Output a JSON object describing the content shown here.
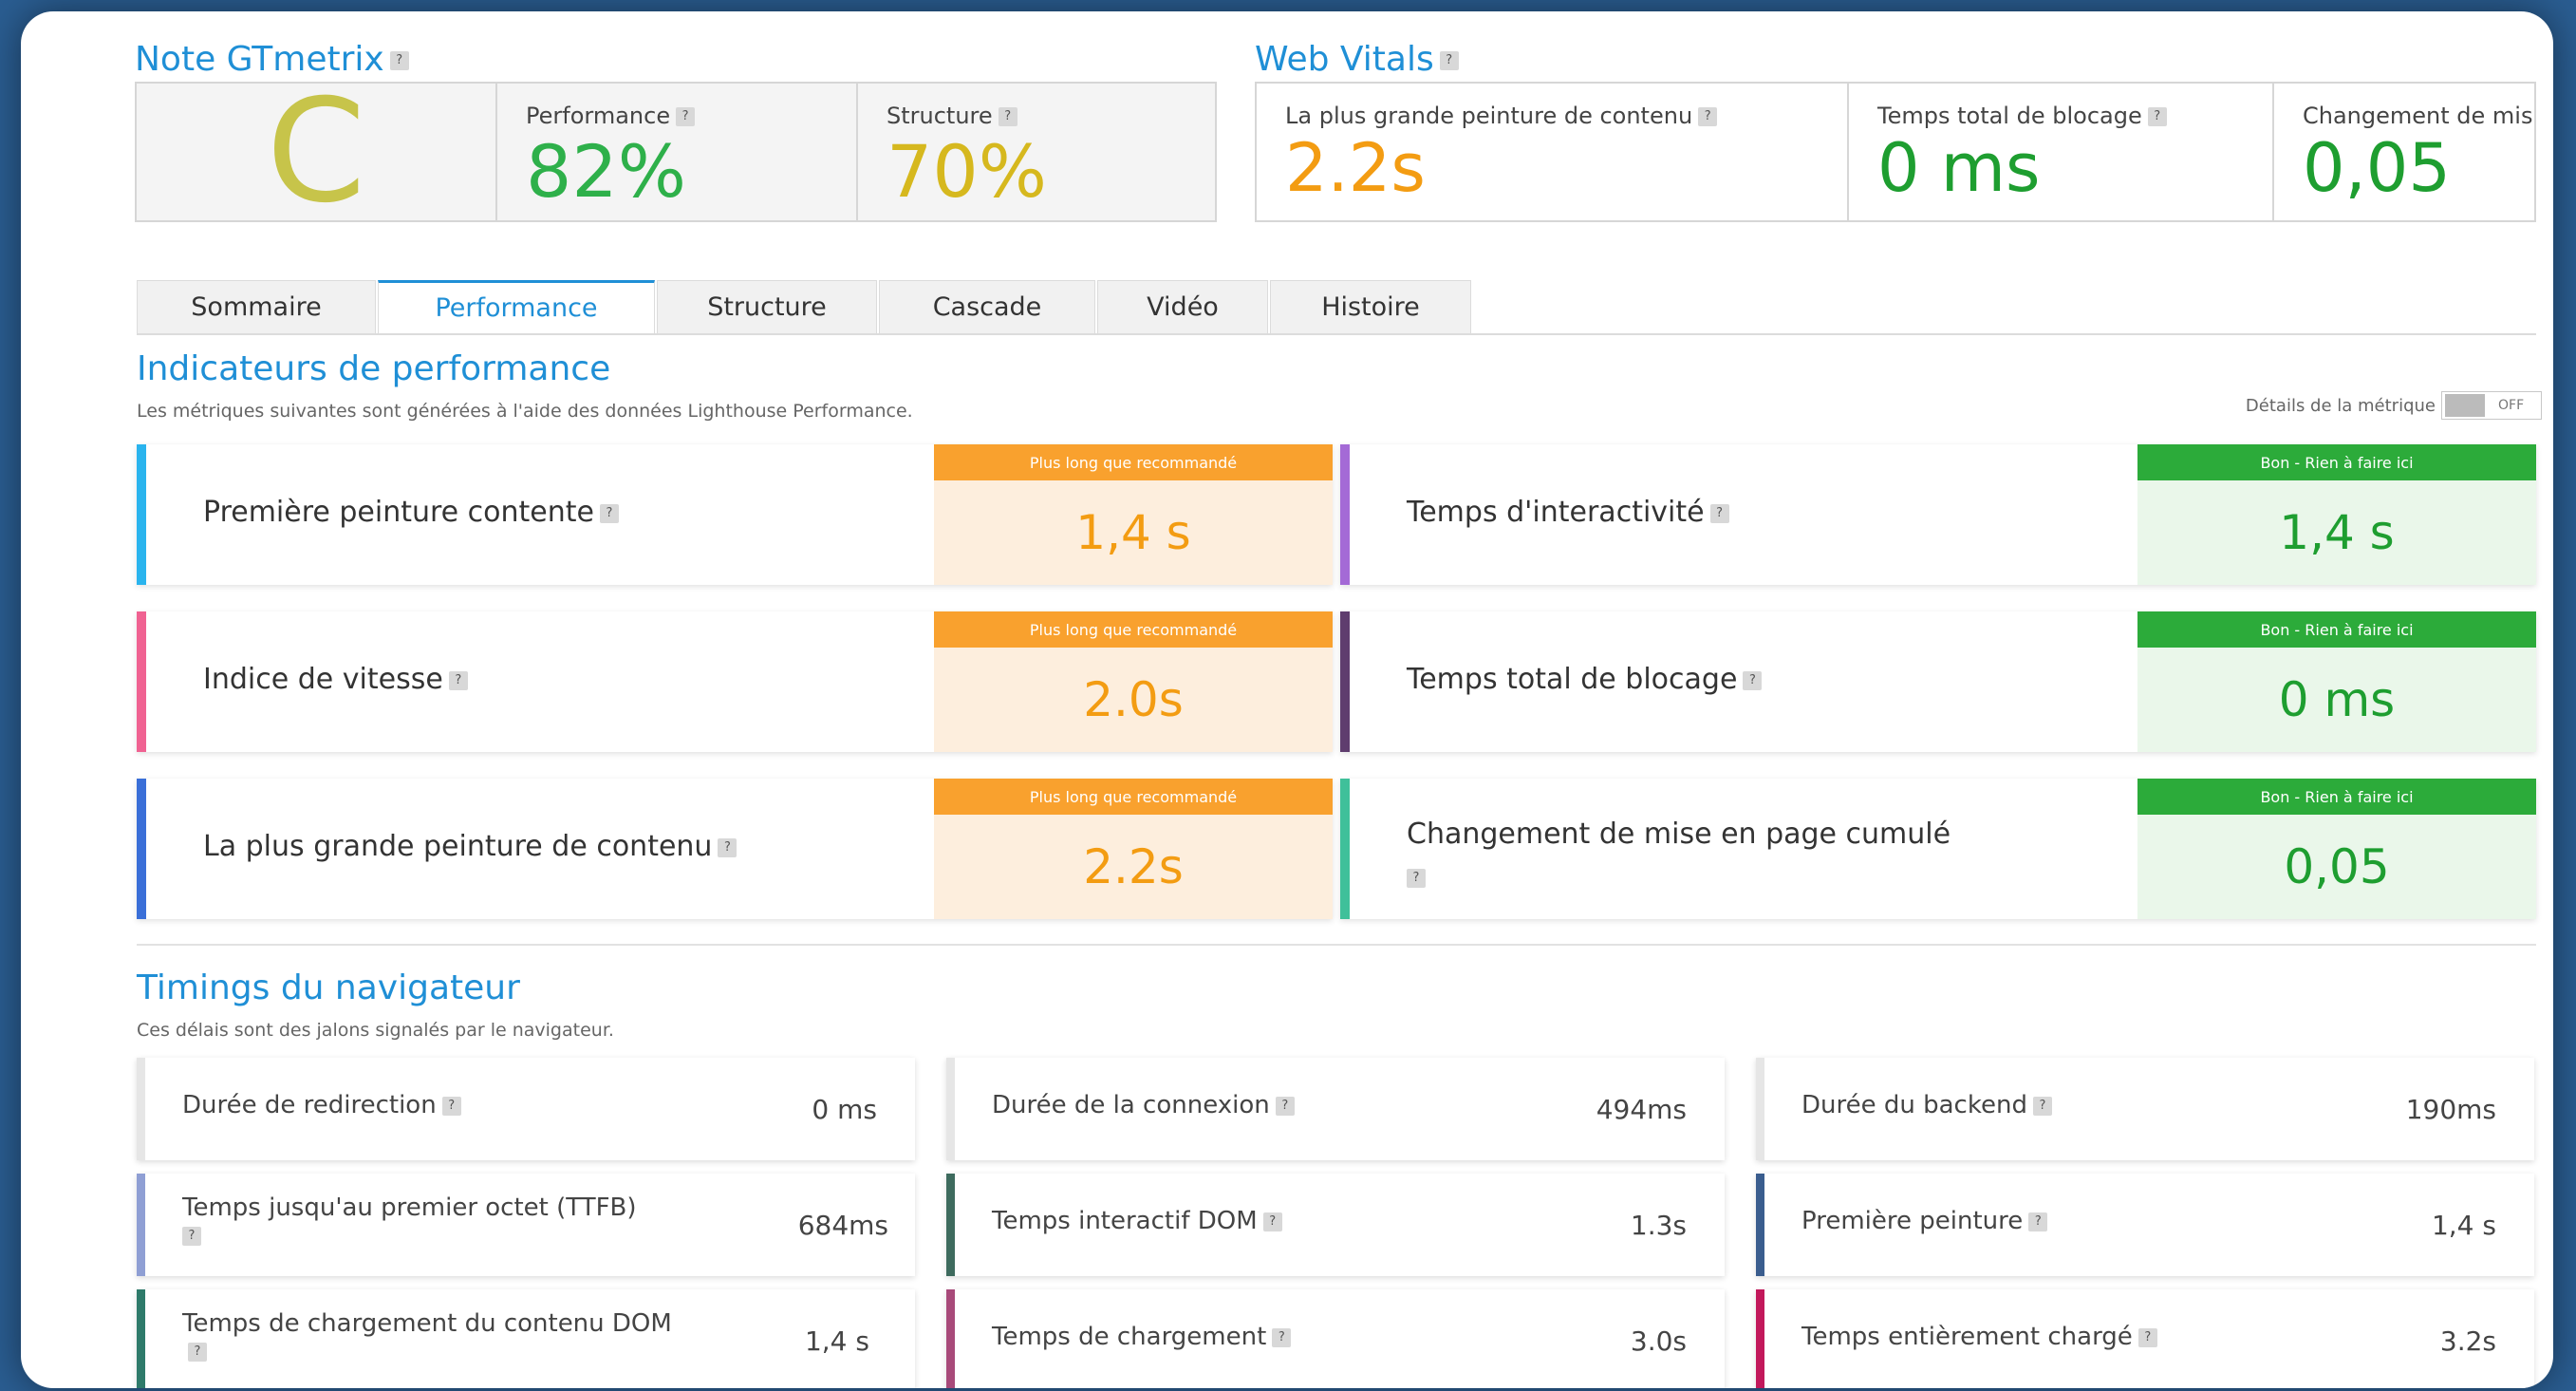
{
  "grade": {
    "title": "Note GTmetrix",
    "letter": "C",
    "performance_label": "Performance",
    "performance_value": "82%",
    "structure_label": "Structure",
    "structure_value": "70%"
  },
  "vitals": {
    "title": "Web Vitals",
    "lcp_label": "La plus grande peinture de contenu",
    "lcp_value": "2.2s",
    "tbt_label": "Temps total de blocage",
    "tbt_value": "0 ms",
    "cls_label": "Changement de mis",
    "cls_value": "0,05"
  },
  "tabs": [
    {
      "label": "Sommaire"
    },
    {
      "label": "Performance"
    },
    {
      "label": "Structure"
    },
    {
      "label": "Cascade"
    },
    {
      "label": "Vidéo"
    },
    {
      "label": "Histoire"
    }
  ],
  "indicators": {
    "title": "Indicateurs de performance",
    "subtitle": "Les métriques suivantes sont générées à l'aide des données Lighthouse Performance.",
    "toggle_label": "Détails de la métrique",
    "toggle_state": "OFF",
    "cards": [
      {
        "name": "Première peinture contente",
        "status": "Plus long que recommandé",
        "value": "1,4 s"
      },
      {
        "name": "Temps d'interactivité",
        "status": "Bon - Rien à faire ici",
        "value": "1,4 s"
      },
      {
        "name": "Indice de vitesse",
        "status": "Plus long que recommandé",
        "value": "2.0s"
      },
      {
        "name": "Temps total de blocage",
        "status": "Bon - Rien à faire ici",
        "value": "0 ms"
      },
      {
        "name": "La plus grande peinture de contenu",
        "status": "Plus long que recommandé",
        "value": "2.2s"
      },
      {
        "name": "Changement de mise en page cumulé",
        "status": "Bon - Rien à faire ici",
        "value": "0,05"
      }
    ]
  },
  "timings": {
    "title": "Timings du navigateur",
    "subtitle": "Ces délais sont des jalons signalés par le navigateur.",
    "items": [
      {
        "label": "Durée de redirection",
        "value": "0 ms"
      },
      {
        "label": "Durée de la connexion",
        "value": "494ms"
      },
      {
        "label": "Durée du backend",
        "value": "190ms"
      },
      {
        "label": "Temps jusqu'au premier octet (TTFB)",
        "value": "684ms"
      },
      {
        "label": "Temps interactif DOM",
        "value": "1.3s"
      },
      {
        "label": "Première peinture",
        "value": "1,4 s"
      },
      {
        "label": "Temps de chargement du contenu DOM",
        "value": "1,4 s"
      },
      {
        "label": "Temps de chargement",
        "value": "3.0s"
      },
      {
        "label": "Temps entièrement chargé",
        "value": "3.2s"
      }
    ]
  },
  "help_icon_glyph": "?",
  "colors": {
    "accent": "#1f8fd6",
    "grade_c": "#c7c44a",
    "performance": "#2eb04a",
    "structure": "#d6b81e",
    "warn": "#f9a12e",
    "good": "#2cab3a"
  }
}
